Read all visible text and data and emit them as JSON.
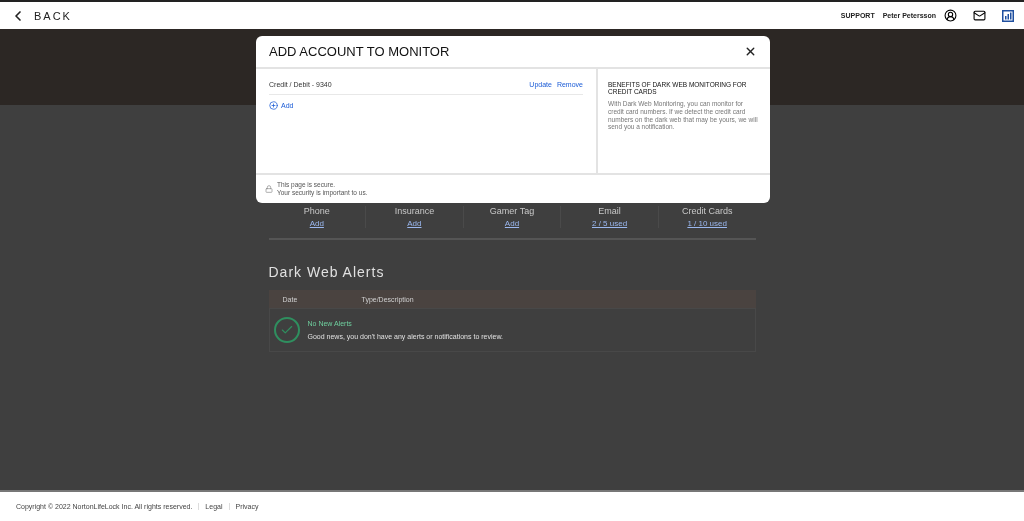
{
  "header": {
    "back": "BACK",
    "support": "SUPPORT",
    "user": "Peter Petersson"
  },
  "accounts": [
    {
      "label": "Phone",
      "link": "Add"
    },
    {
      "label": "Insurance",
      "link": "Add"
    },
    {
      "label": "Gamer Tag",
      "link": "Add"
    },
    {
      "label": "Email",
      "link": "2 / 5 used"
    },
    {
      "label": "Credit Cards",
      "link": "1 / 10 used"
    }
  ],
  "alerts": {
    "title": "Dark Web Alerts",
    "columns": [
      "Date",
      "Type/Description"
    ],
    "empty_title": "No New Alerts",
    "empty_text": "Good news, you don't have any alerts or notifications to review."
  },
  "modal": {
    "title": "ADD ACCOUNT TO MONITOR",
    "items": [
      {
        "name": "Credit / Debit - 9340",
        "actions": [
          "Update",
          "Remove"
        ]
      }
    ],
    "add": "Add",
    "info_title": "BENEFITS OF DARK WEB MONITORING FOR CREDIT CARDS",
    "info_text": "With Dark Web Monitoring, you can monitor for credit card numbers. If we detect the credit card numbers on the dark web that may be yours, we will send you a notification.",
    "secure": [
      "This page is secure.",
      "Your security is important to us."
    ]
  },
  "footer": {
    "copyright": "Copyright © 2022 NortonLifeLock Inc. All rights reserved.",
    "links": [
      "Legal",
      "Privacy"
    ]
  }
}
